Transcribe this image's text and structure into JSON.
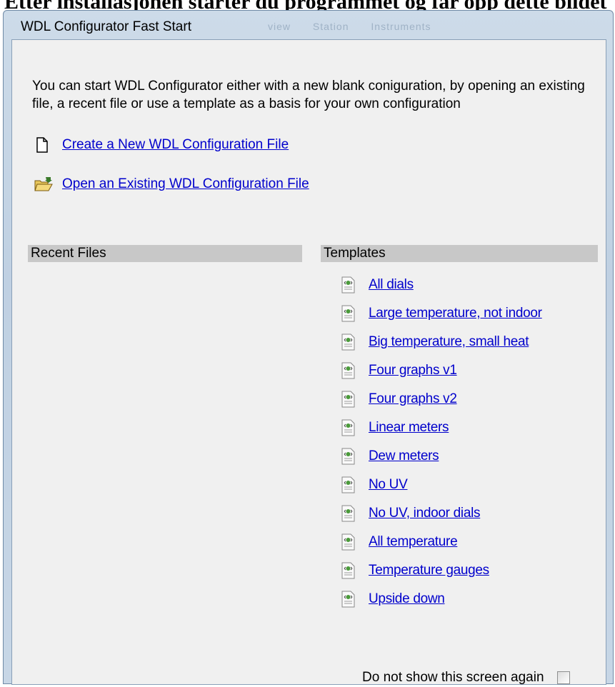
{
  "heading": "Etter installasjonen starter du programmet og får opp dette bildet",
  "window": {
    "title": "WDL Configurator Fast Start",
    "ghost_tabs": [
      "view",
      "Station",
      "Instruments"
    ]
  },
  "intro": "You can start WDL Configurator either with a new blank coniguration, by opening an existing file, a recent file or use a template as a basis for your own configuration",
  "actions": {
    "create_label": "Create a New WDL Configuration File",
    "open_label": "Open an Existing WDL Configuration File"
  },
  "recent": {
    "header": "Recent Files"
  },
  "templates": {
    "header": "Templates",
    "items": [
      {
        "label": "All dials"
      },
      {
        "label": "Large temperature, not indoor"
      },
      {
        "label": "Big temperature, small heat"
      },
      {
        "label": "Four graphs v1"
      },
      {
        "label": "Four graphs v2"
      },
      {
        "label": "Linear meters"
      },
      {
        "label": "Dew meters"
      },
      {
        "label": "No UV"
      },
      {
        "label": "No UV, indoor dials"
      },
      {
        "label": "All temperature"
      },
      {
        "label": "Temperature gauges"
      },
      {
        "label": "Upside down"
      }
    ]
  },
  "footer": {
    "checkbox_label": "Do not show this screen again",
    "checked": false
  },
  "icons": {
    "new": "new-file-icon",
    "open": "open-folder-icon",
    "template": "template-file-icon"
  },
  "colors": {
    "link": "#0000cc",
    "section_header": "#c8c8c8",
    "client_bg": "#f0f0f0"
  }
}
